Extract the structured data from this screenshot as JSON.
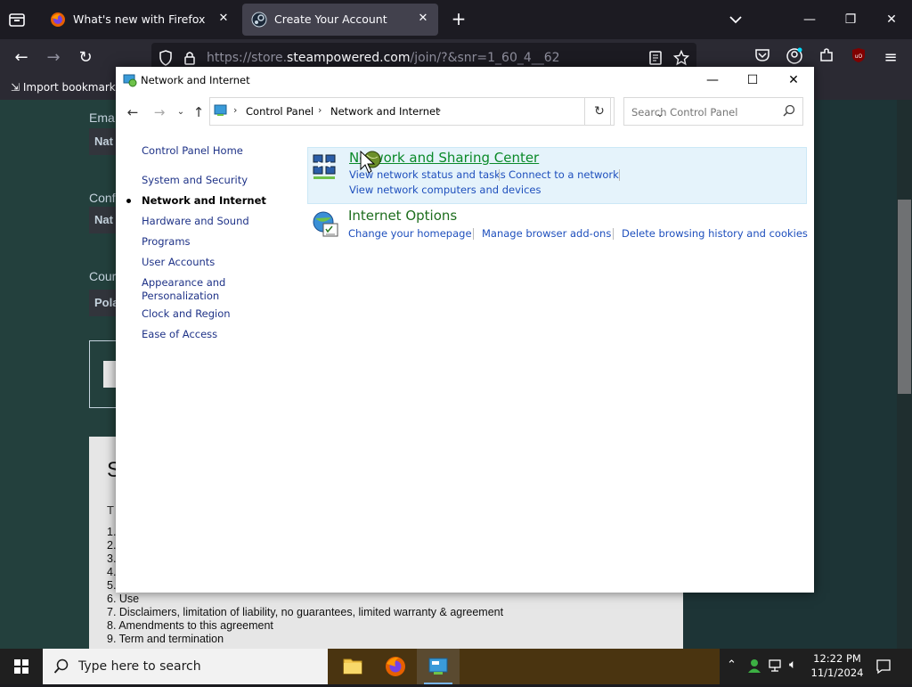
{
  "browser": {
    "tabs": [
      {
        "title": "What's new with Firefox",
        "active": false
      },
      {
        "title": "Create Your Account",
        "active": true
      }
    ],
    "url_prefix": "https://store.",
    "url_host": "steampowered.com",
    "url_path": "/join/?&snr=1_60_4__62",
    "bookmarks_toolbar": {
      "import_label": "Import bookmarks..."
    }
  },
  "page": {
    "labels": {
      "email": "Ema",
      "confirm": "Conf",
      "country": "Cour"
    },
    "fields": {
      "email": "Nat",
      "confirm": "Nat",
      "country": "Pola"
    },
    "agreement": {
      "heading": "S",
      "sub": "T",
      "lines": [
        "1.",
        "2.",
        "3.",
        "4.",
        "5.",
        "6. Use",
        "7. Disclaimers, limitation of liability, no guarantees, limited warranty & agreement",
        "8. Amendments to this agreement",
        "9. Term and termination"
      ]
    }
  },
  "control_panel": {
    "window_title": "Network and Internet",
    "breadcrumb": [
      "Control Panel",
      "Network and Internet"
    ],
    "search_placeholder": "Search Control Panel",
    "sidebar": [
      {
        "label": "Control Panel Home",
        "active": false
      },
      {
        "label": "System and Security",
        "active": false
      },
      {
        "label": "Network and Internet",
        "active": true
      },
      {
        "label": "Hardware and Sound",
        "active": false
      },
      {
        "label": "Programs",
        "active": false
      },
      {
        "label": "User Accounts",
        "active": false
      },
      {
        "label": "Appearance and Personalization",
        "active": false
      },
      {
        "label": "Clock and Region",
        "active": false
      },
      {
        "label": "Ease of Access",
        "active": false
      }
    ],
    "categories": [
      {
        "title": "Network and Sharing Center",
        "icon": "network-sharing-icon",
        "links": [
          "View network status and tasks",
          "Connect to a network",
          "View network computers and devices"
        ]
      },
      {
        "title": "Internet Options",
        "icon": "internet-options-icon",
        "links": [
          "Change your homepage",
          "Manage browser add-ons",
          "Delete browsing history and cookies"
        ]
      }
    ]
  },
  "taskbar": {
    "search_placeholder": "Type here to search",
    "time": "12:22 PM",
    "date": "11/1/2024"
  },
  "colors": {
    "accent": "#0a8a29",
    "link": "#1e4fbd",
    "firefox_tab_active": "#42414d"
  }
}
